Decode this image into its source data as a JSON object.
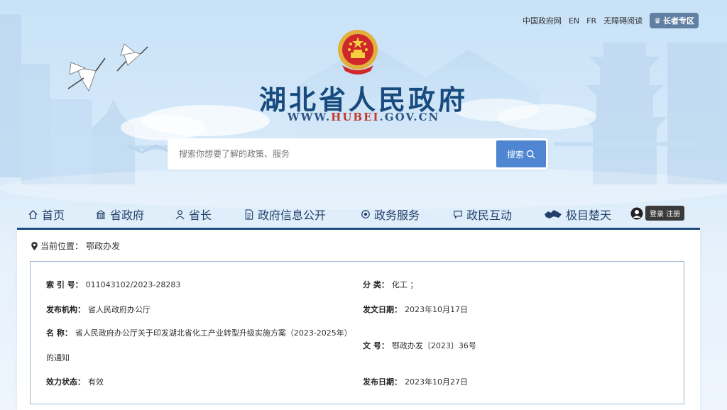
{
  "top_links": {
    "gov_cn": "中国政府网",
    "en": "EN",
    "fr": "FR",
    "accessibility": "无障碍阅读",
    "elder": "长者专区"
  },
  "header": {
    "title": "湖北省人民政府",
    "url_prefix": "WWW.",
    "url_domain": "HUBEI",
    "url_suffix": ".GOV.CN"
  },
  "search": {
    "placeholder": "搜索你想要了解的政策、服务",
    "button": "搜索"
  },
  "nav": {
    "items": [
      {
        "label": "首页",
        "icon": "home-icon"
      },
      {
        "label": "省政府",
        "icon": "building-icon"
      },
      {
        "label": "省长",
        "icon": "person-icon"
      },
      {
        "label": "政府信息公开",
        "icon": "document-icon"
      },
      {
        "label": "政务服务",
        "icon": "service-icon"
      },
      {
        "label": "政民互动",
        "icon": "chat-icon"
      },
      {
        "label": "极目楚天",
        "icon": "map-icon"
      }
    ],
    "login": "登录 注册"
  },
  "breadcrumb": {
    "prefix": "当前位置：",
    "current": "鄂政办发"
  },
  "meta": {
    "index_label": "索 引 号：",
    "index_value": "011043102/2023-28283",
    "category_label": "分 类：",
    "category_value": "化工 ；",
    "publisher_label": "发布机构：",
    "publisher_value": "省人民政府办公厅",
    "issue_date_label": "发文日期：",
    "issue_date_value": "2023年10月17日",
    "name_label": "名 称：",
    "name_value_line1": "省人民政府办公厅关于印发湖北省化工产业转型升级实施方案（2023-2025年）",
    "name_value_line2": "的通知",
    "doc_no_label": "文 号：",
    "doc_no_value": "鄂政办发〔2023〕36号",
    "status_label": "效力状态：",
    "status_value": "有效",
    "publish_date_label": "发布日期：",
    "publish_date_value": "2023年10月27日"
  },
  "colors": {
    "title": "#174a7d",
    "nav_text": "#23406b",
    "accent": "#4e86d1",
    "underline": "#1f4e86"
  }
}
